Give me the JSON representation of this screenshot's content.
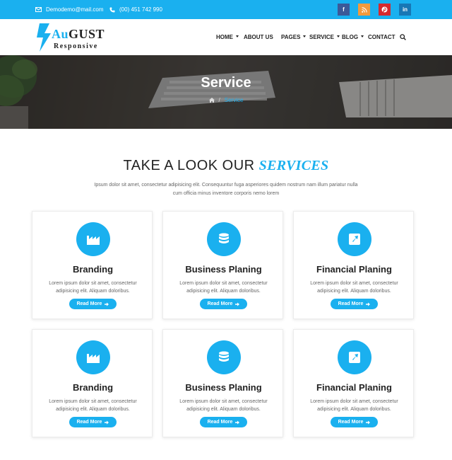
{
  "topbar": {
    "email": "Demodemo@mail.com",
    "phone": "(00) 451 742 990",
    "social": [
      {
        "name": "facebook",
        "glyph": "f",
        "color": "#3b5998"
      },
      {
        "name": "rss",
        "color": "#f29a3c"
      },
      {
        "name": "pinterest",
        "color": "#d5282e"
      },
      {
        "name": "linkedin",
        "glyph": "in",
        "color": "#1777b5"
      }
    ]
  },
  "logo": {
    "brand_accent": "Au",
    "brand_rest": "GUST",
    "tagline": "Responsive"
  },
  "nav": {
    "items": [
      {
        "label": "HOME",
        "dropdown": true
      },
      {
        "label": "ABOUT US",
        "dropdown": false
      },
      {
        "label": "PAGES",
        "dropdown": true
      },
      {
        "label": "SERVICE",
        "dropdown": true
      },
      {
        "label": "BLOG",
        "dropdown": true
      },
      {
        "label": "CONTACT",
        "dropdown": false
      }
    ]
  },
  "hero": {
    "title": "Service",
    "breadcrumb_separator": "/",
    "breadcrumb_current": "Service"
  },
  "section": {
    "title_plain": "TAKE A LOOK OUR",
    "title_accent": "SERVICES",
    "description": "Ipsum dolor sit amet, consectetur adipisicing elit. Consequuntur fuga asperiores quidem nostrum nam illum pariatur nulla cum officia minus inventore corporis nemo lorem"
  },
  "cards": [
    {
      "title": "Branding",
      "icon": "factory-icon",
      "text": "Lorem ipsum dolor sit amet, consectetur adipisicing elit. Aliquam doloribus.",
      "button": "Read More"
    },
    {
      "title": "Business Planing",
      "icon": "database-icon",
      "text": "Lorem ipsum dolor sit amet, consectetur adipisicing elit. Aliquam doloribus.",
      "button": "Read More"
    },
    {
      "title": "Financial Planing",
      "icon": "external-link-icon",
      "text": "Lorem ipsum dolor sit amet, consectetur adipisicing elit. Aliquam doloribus.",
      "button": "Read More"
    },
    {
      "title": "Branding",
      "icon": "factory-icon",
      "text": "Lorem ipsum dolor sit amet, consectetur adipisicing elit. Aliquam doloribus.",
      "button": "Read More"
    },
    {
      "title": "Business Planing",
      "icon": "database-icon",
      "text": "Lorem ipsum dolor sit amet, consectetur adipisicing elit. Aliquam doloribus.",
      "button": "Read More"
    },
    {
      "title": "Financial Planing",
      "icon": "external-link-icon",
      "text": "Lorem ipsum dolor sit amet, consectetur adipisicing elit. Aliquam doloribus.",
      "button": "Read More"
    }
  ],
  "colors": {
    "accent": "#1ab0ef",
    "heading": "#222222",
    "body_text": "#666666"
  }
}
